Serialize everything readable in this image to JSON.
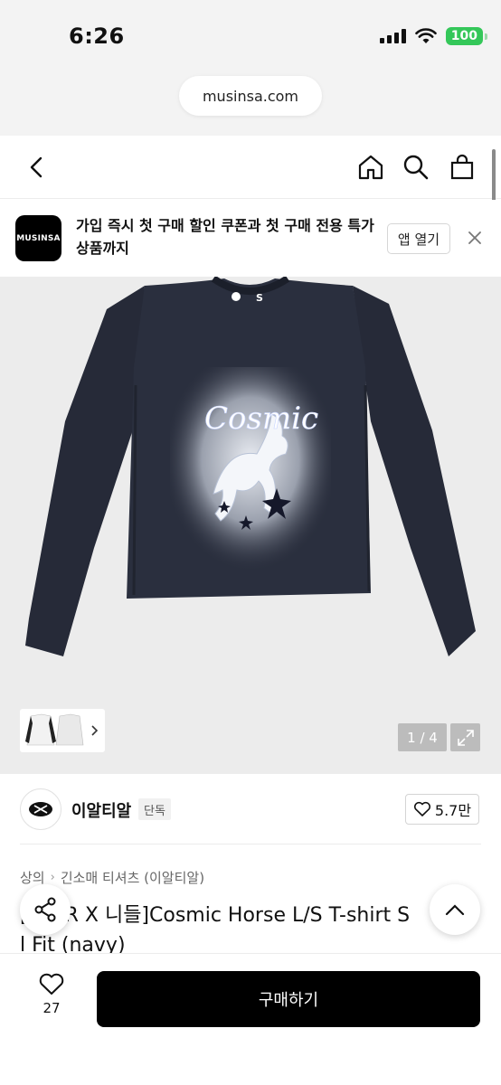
{
  "status_bar": {
    "time": "6:26",
    "battery": "100"
  },
  "browser": {
    "url": "musinsa.com"
  },
  "banner": {
    "logo_text": "MUSINSA",
    "message": "가입 즉시 첫 구매 할인 쿠폰과 첫 구매 전용 특가 상품까지",
    "open_app_label": "앱 열기"
  },
  "gallery": {
    "counter": "1 / 4",
    "shirt_print_text": "Cosmic",
    "tag_text": "S"
  },
  "brand": {
    "name": "이알티알",
    "badge": "단독",
    "likes": "5.7만"
  },
  "breadcrumb": {
    "category": "상의",
    "subcategory": "긴소매 티셔츠 (이알티알)"
  },
  "product": {
    "title_line1": "[ERTR X 니들]Cosmic Horse L/S T-shirt S",
    "title_line2": "l Fit (navy)"
  },
  "bottom_bar": {
    "wish_count": "27",
    "buy_label": "구매하기"
  },
  "colors": {
    "accent": "#000000",
    "shirt": "#262a38",
    "battery": "#34c759"
  }
}
